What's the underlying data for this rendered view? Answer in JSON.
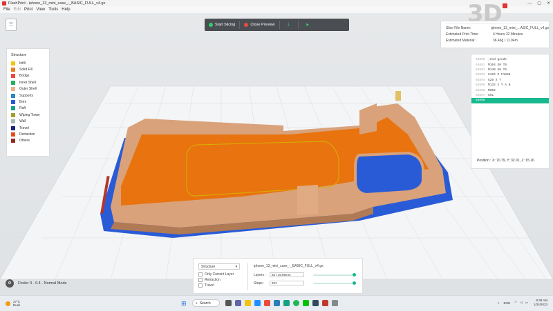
{
  "window": {
    "title": "FlashPrint - iphone_13_mini_case_-_BASIC_FULL_v4.gx",
    "controls": [
      "—",
      "▢",
      "✕"
    ]
  },
  "menu": [
    {
      "label": "File",
      "dim": false
    },
    {
      "label": "Edit",
      "dim": true
    },
    {
      "label": "Print",
      "dim": false
    },
    {
      "label": "View",
      "dim": false
    },
    {
      "label": "Tools",
      "dim": false
    },
    {
      "label": "Help",
      "dim": false
    }
  ],
  "brand": {
    "logo": "3D"
  },
  "toolbar": {
    "start_label": "Start Slicing",
    "close_label": "Close Preview",
    "icons": [
      "download-icon",
      "send-to-printer-icon"
    ]
  },
  "legend": {
    "title": "Structure",
    "items": [
      {
        "label": "Infill",
        "color": "#f1c40f"
      },
      {
        "label": "Solid Fill",
        "color": "#e67e22"
      },
      {
        "label": "Bridge",
        "color": "#e74c3c"
      },
      {
        "label": "Inner Shell",
        "color": "#27ae60"
      },
      {
        "label": "Outer Shell",
        "color": "#e8b48a"
      },
      {
        "label": "Supports",
        "color": "#2e86c1"
      },
      {
        "label": "Brim",
        "color": "#2a5bd7"
      },
      {
        "label": "Raft",
        "color": "#16a085"
      },
      {
        "label": "Wiping Tower",
        "color": "#a3a035"
      },
      {
        "label": "Wall",
        "color": "#aab7b8"
      },
      {
        "label": "Travel",
        "color": "#1a237e"
      },
      {
        "label": "Retraction",
        "color": "#e74c1c"
      },
      {
        "label": "Others",
        "color": "#922b21"
      }
    ]
  },
  "slice_info": {
    "file_name_label": "Slice File Name:",
    "file_name": "iphone_13_mini_...ASIC_FULL_v4.gx",
    "time_label": "Estimated Print Time:",
    "time": "4 Hours 32 Minutes",
    "material_label": "Estimated Material:",
    "material": "36.46g / 11.94m"
  },
  "gcode": {
    "lines": [
      {
        "num": "68890",
        "cmd": ";end gcode",
        "highlight": false
      },
      {
        "num": "68891",
        "cmd": "M104 S0 T0",
        "highlight": false
      },
      {
        "num": "68892",
        "cmd": "M140 S0 T0",
        "highlight": false
      },
      {
        "num": "68893",
        "cmd": "G162 Z F1800",
        "highlight": false
      },
      {
        "num": "68894",
        "cmd": "G28 X Y",
        "highlight": false
      },
      {
        "num": "68895",
        "cmd": "M132 X Y A B",
        "highlight": false
      },
      {
        "num": "68896",
        "cmd": "M652",
        "highlight": false
      },
      {
        "num": "68897",
        "cmd": "G91",
        "highlight": false
      },
      {
        "num": "68898",
        "cmd": "",
        "highlight": true
      }
    ],
    "position": "Position :   X: 70.79, Y: 32.01, Z: 15.16"
  },
  "bottom_panel": {
    "dropdown": "Structure",
    "checkboxes": [
      "Only Current Layer",
      "Retraction",
      "Travel"
    ],
    "filename": "iphone_13_mini_case_-_BASIC_FULL_v4.gx",
    "layers_label": "Layers :",
    "layers_value": "83 / 15.06mm",
    "steps_label": "Steps :",
    "steps_value": "331",
    "layers_fraction": 1.0,
    "steps_fraction": 1.0
  },
  "status": {
    "finder": "Finder 3 - 0.4 - Normal Mode"
  },
  "taskbar": {
    "weather_temp": "27°C",
    "weather_desc": "Dusk",
    "search": "Search",
    "lang": "ENG",
    "time": "8:39 AM",
    "date": "1/24/2023"
  }
}
